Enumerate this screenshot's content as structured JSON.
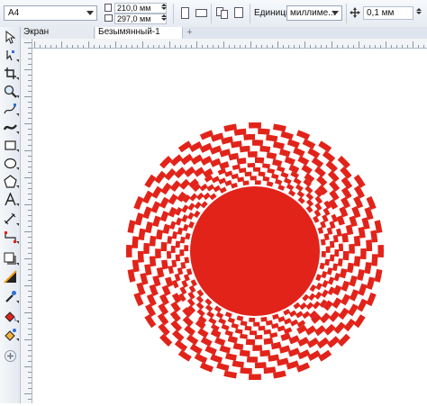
{
  "property_bar": {
    "paper_size": "A4",
    "width_value": "210,0 мм",
    "height_value": "297,0 мм",
    "units_label": "Единицы:",
    "units_value": "миллиме...",
    "nudge_value": "0,1 мм"
  },
  "tabs": [
    {
      "label": "Экран приветствия",
      "active": false
    },
    {
      "label": "Безымянный-1",
      "active": true
    }
  ],
  "toolbox": {
    "tools": [
      "pick-tool",
      "shape-tool",
      "crop-tool",
      "zoom-tool",
      "freehand-tool",
      "artistic-media-tool",
      "rectangle-tool",
      "ellipse-tool",
      "polygon-tool",
      "text-tool",
      "parallel-dimension-tool",
      "connector-tool",
      "drop-shadow-tool",
      "transparency-tool",
      "eyedropper-tool",
      "interactive-fill-tool",
      "smart-fill-tool",
      "add-tool"
    ]
  },
  "artwork": {
    "pattern": "circular red checkered mandala",
    "colors": {
      "fill": "#e2231a",
      "background": "#ffffff"
    }
  }
}
